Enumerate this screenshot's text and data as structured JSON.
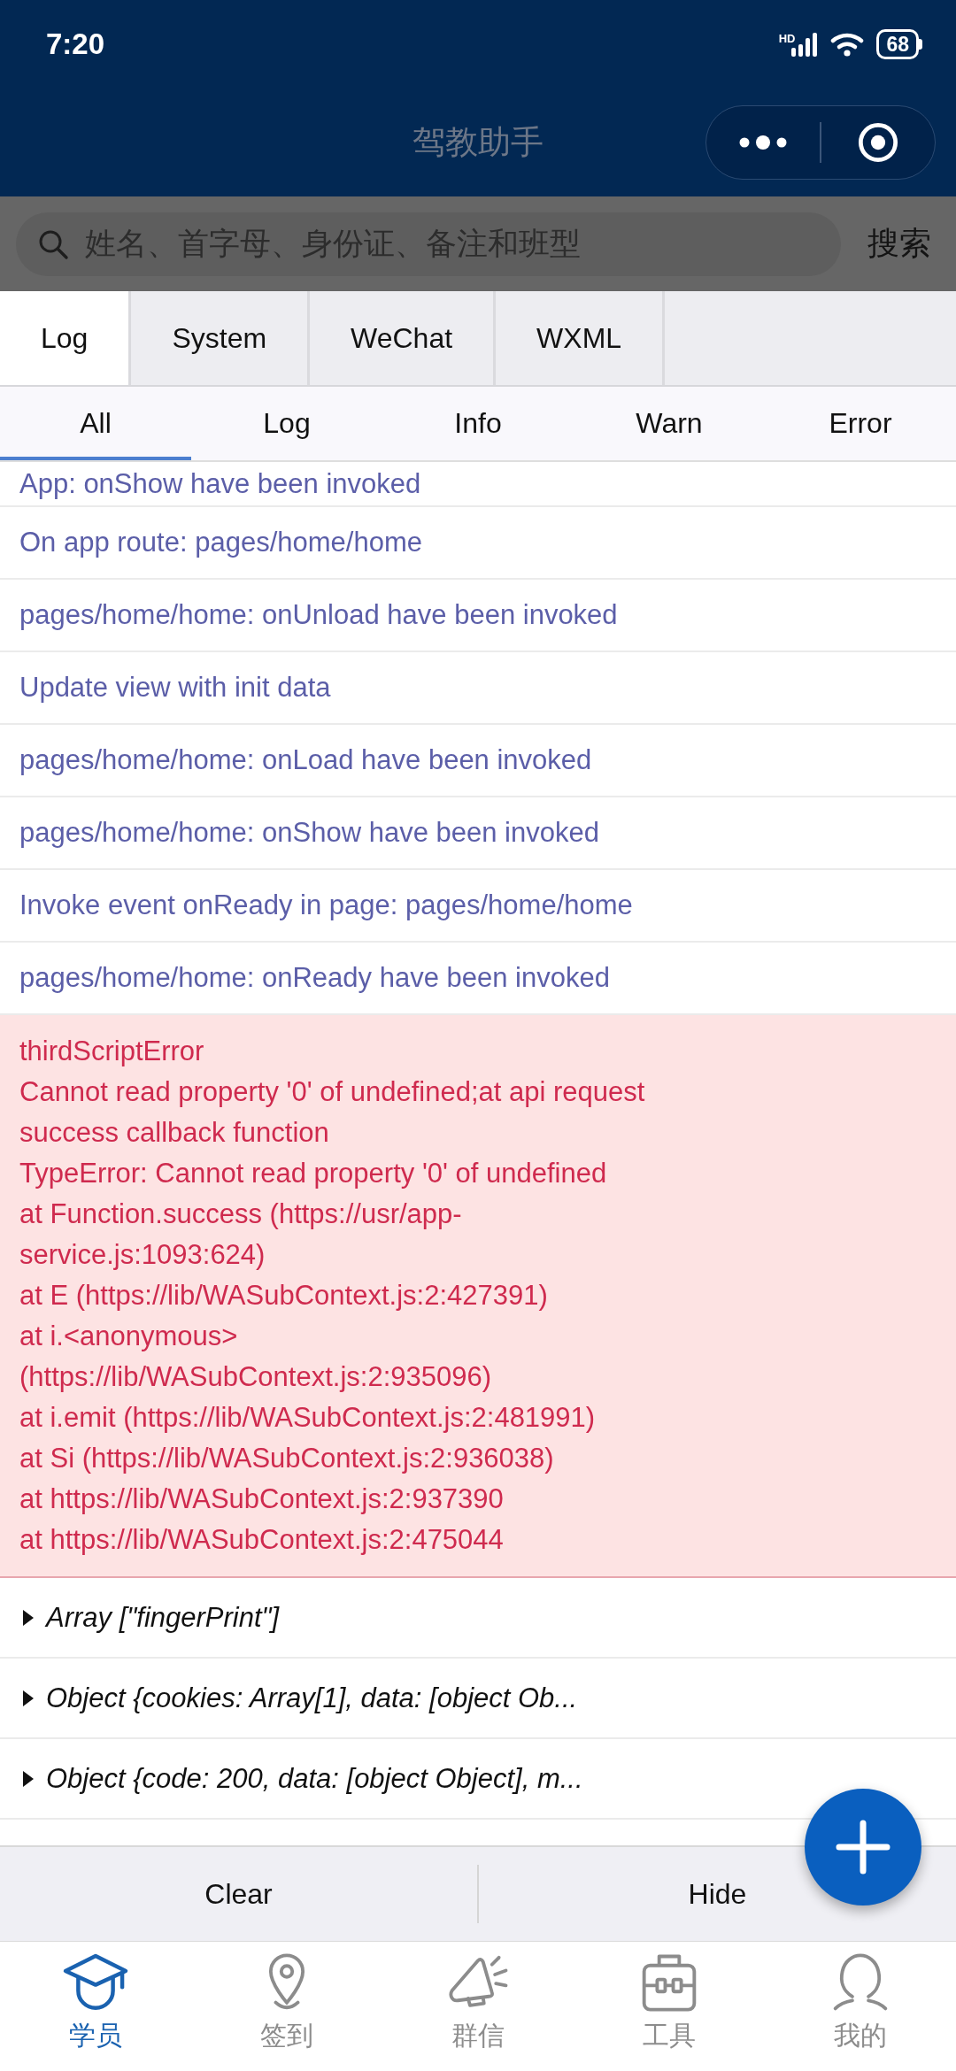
{
  "status_bar": {
    "time": "7:20",
    "network_label": "HD",
    "battery": "68"
  },
  "header": {
    "title": "驾教助手"
  },
  "search": {
    "placeholder": "姓名、首字母、身份证、备注和班型",
    "button": "搜索"
  },
  "console": {
    "tabs": [
      {
        "label": "Log",
        "selected": true
      },
      {
        "label": "System",
        "selected": false
      },
      {
        "label": "WeChat",
        "selected": false
      },
      {
        "label": "WXML",
        "selected": false
      }
    ],
    "filters": [
      {
        "label": "All",
        "selected": true
      },
      {
        "label": "Log",
        "selected": false
      },
      {
        "label": "Info",
        "selected": false
      },
      {
        "label": "Warn",
        "selected": false
      },
      {
        "label": "Error",
        "selected": false
      }
    ],
    "entries": [
      {
        "kind": "log",
        "text": "App: onShow have been invoked"
      },
      {
        "kind": "log",
        "text": "On app route: pages/home/home"
      },
      {
        "kind": "log",
        "text": "pages/home/home: onUnload have been invoked"
      },
      {
        "kind": "log",
        "text": "Update view with init data"
      },
      {
        "kind": "log",
        "text": "pages/home/home: onLoad have been invoked"
      },
      {
        "kind": "log",
        "text": "pages/home/home: onShow have been invoked"
      },
      {
        "kind": "log",
        "text": "Invoke event onReady in page: pages/home/home"
      },
      {
        "kind": "log",
        "text": "pages/home/home: onReady have been invoked"
      },
      {
        "kind": "error",
        "text": "thirdScriptError\nCannot read property '0' of undefined;at api request\nsuccess callback function\nTypeError: Cannot read property '0' of undefined\nat Function.success (https://usr/app-\nservice.js:1093:624)\nat E (https://lib/WASubContext.js:2:427391)\nat i.<anonymous>\n(https://lib/WASubContext.js:2:935096)\nat i.emit (https://lib/WASubContext.js:2:481991)\nat Si (https://lib/WASubContext.js:2:936038)\nat https://lib/WASubContext.js:2:937390\nat https://lib/WASubContext.js:2:475044"
      },
      {
        "kind": "object",
        "expanded": false,
        "text": "Array [\"fingerPrint\"]"
      },
      {
        "kind": "object",
        "expanded": false,
        "text": "Object {cookies: Array[1], data: [object Ob..."
      },
      {
        "kind": "object",
        "expanded": false,
        "text": "Object {code: 200, data: [object Object], m..."
      }
    ],
    "actions": [
      "Clear",
      "Hide"
    ]
  },
  "tab_bar": [
    {
      "label": "学员",
      "selected": true
    },
    {
      "label": "签到",
      "selected": false
    },
    {
      "label": "群信",
      "selected": false
    },
    {
      "label": "工具",
      "selected": false
    },
    {
      "label": "我的",
      "selected": false
    }
  ]
}
